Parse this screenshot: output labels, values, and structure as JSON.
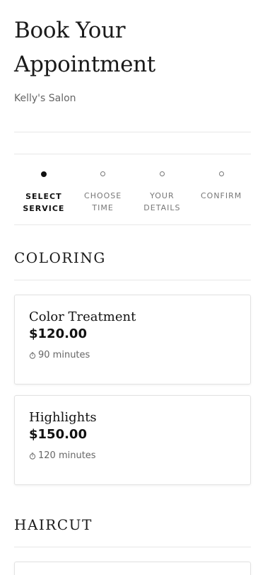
{
  "header": {
    "title": "Book Your Appointment",
    "subtitle": "Kelly's Salon"
  },
  "steps": [
    {
      "label": "SELECT\nSERVICE",
      "active": true
    },
    {
      "label": "CHOOSE\nTIME",
      "active": false
    },
    {
      "label": "YOUR\nDETAILS",
      "active": false
    },
    {
      "label": "CONFIRM",
      "active": false
    }
  ],
  "sections": [
    {
      "title": "COLORING",
      "services": [
        {
          "name": "Color Treatment",
          "price": "$120.00",
          "duration": "90 minutes"
        },
        {
          "name": "Highlights",
          "price": "$150.00",
          "duration": "120 minutes"
        }
      ]
    },
    {
      "title": "HAIRCUT",
      "services": []
    }
  ],
  "icons": {
    "duration": "stopwatch-icon"
  }
}
